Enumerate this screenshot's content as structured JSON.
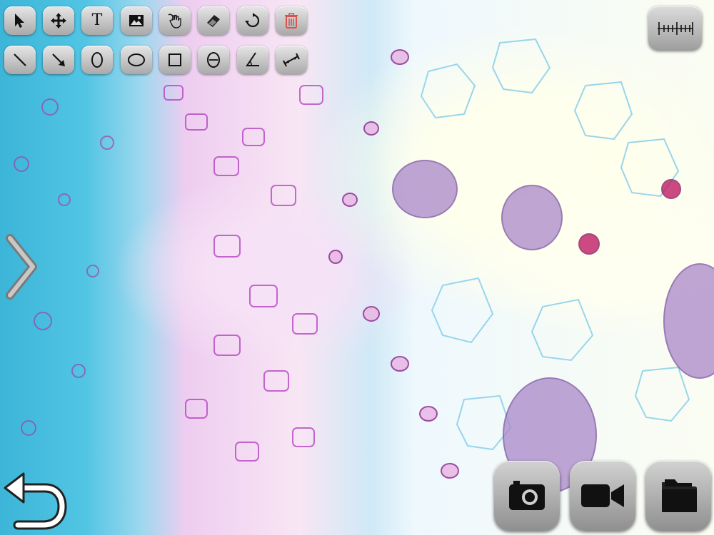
{
  "toolbar": {
    "row1": [
      {
        "icon": "pointer-arrow-icon"
      },
      {
        "icon": "move-cross-icon"
      },
      {
        "icon": "text-icon",
        "label": "T"
      },
      {
        "icon": "image-icon"
      },
      {
        "icon": "hand-draw-icon"
      },
      {
        "icon": "eraser-icon"
      },
      {
        "icon": "rotate-icon"
      },
      {
        "icon": "trash-icon"
      }
    ],
    "row2": [
      {
        "icon": "line-icon"
      },
      {
        "icon": "arrow-line-icon"
      },
      {
        "icon": "ellipse-vertical-icon"
      },
      {
        "icon": "ellipse-horizontal-icon"
      },
      {
        "icon": "rectangle-icon"
      },
      {
        "icon": "circle-diameter-icon"
      },
      {
        "icon": "angle-icon"
      },
      {
        "icon": "measure-length-icon"
      }
    ]
  },
  "right_controls": {
    "scale": "ruler-scale-icon"
  },
  "navigation": {
    "side": "chevron-right-icon",
    "undo": "undo-icon"
  },
  "bottom_buttons": [
    {
      "icon": "camera-icon"
    },
    {
      "icon": "video-camera-icon"
    },
    {
      "icon": "folder-icon"
    }
  ],
  "colors": {
    "button_light": "#e6e6e6",
    "button_dark": "#a9a9a9",
    "trash_red": "#d9534f",
    "stain_cyan": "#3cb5d8",
    "stain_magenta": "#9b2fa8"
  }
}
